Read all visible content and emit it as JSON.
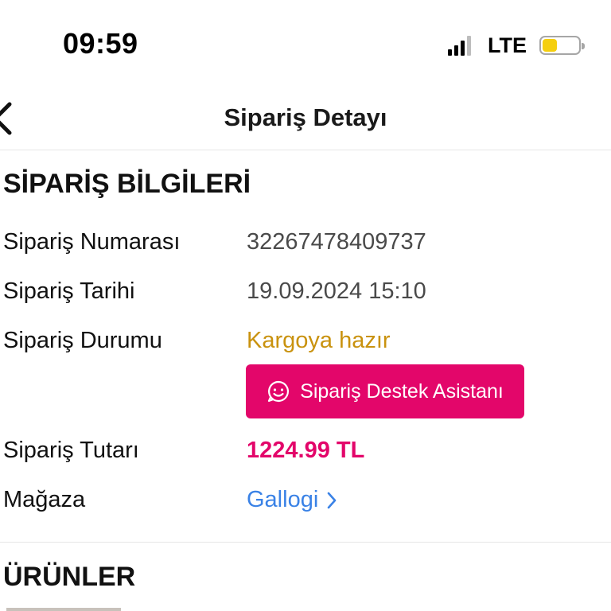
{
  "status_bar": {
    "time": "09:59",
    "network": "LTE",
    "battery_icon": "battery-low-icon",
    "battery_color": "#f5cf0f",
    "signal_icon": "signal-bars-icon"
  },
  "nav": {
    "back_icon": "chevron-left-icon",
    "title": "Sipariş Detayı"
  },
  "order_info": {
    "section_title": "SİPARİŞ BİLGİLERİ",
    "rows": [
      {
        "label": "Sipariş Numarası",
        "value": "32267478409737"
      },
      {
        "label": "Sipariş Tarihi",
        "value": "19.09.2024 15:10"
      },
      {
        "label": "Sipariş Durumu",
        "value": "Kargoya hazır"
      },
      {
        "label": "Sipariş Tutarı",
        "value": "1224.99 TL"
      },
      {
        "label": "Mağaza",
        "value": "Gallogi"
      }
    ],
    "support_button_label": "Sipariş Destek Asistanı",
    "support_icon": "chat-smile-icon",
    "store_chevron_icon": "chevron-right-icon"
  },
  "products": {
    "section_title": "ÜRÜNLER"
  },
  "colors": {
    "status_pending": "#c9920e",
    "accent_pink": "#e3066a",
    "link_blue": "#3a82e6",
    "battery_yellow": "#f5cf0f"
  }
}
